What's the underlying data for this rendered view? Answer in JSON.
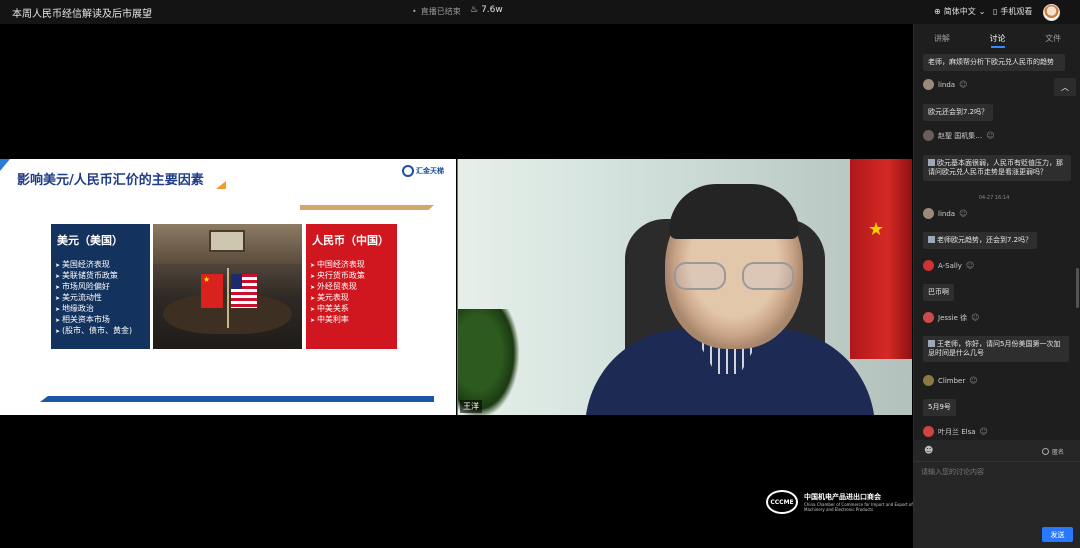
{
  "header": {
    "title": "本周人民币经信解读及后市展望",
    "live_status": "直播已结束",
    "views": "7.6w",
    "language": "简体中文",
    "mobile_watch": "手机观看"
  },
  "slide": {
    "heading": "影响美元/人民币汇价的主要因素",
    "logo_text": "汇金天梯",
    "us_box": {
      "title": "美元（美国）",
      "items": [
        "美国经济表现",
        "美联储货币政策",
        "市场风险偏好",
        "美元流动性",
        "地缘政治",
        "相关资本市场",
        "(股市、债市、黄金)"
      ]
    },
    "cn_box": {
      "title": "人民币（中国）",
      "items": [
        "中国经济表现",
        "央行货币政策",
        "外经贸表现",
        "美元表现",
        "中美关系",
        "中美利率"
      ]
    }
  },
  "camera": {
    "speaker_name": "王洋"
  },
  "sponsor": {
    "name_cn": "中国机电产品进出口商会",
    "name_en": "China Chamber of Commerce for Import and Export of Machinery and Electronic Products",
    "mark": "CCCME"
  },
  "panel": {
    "tabs": [
      "讲解",
      "讨论",
      "文件"
    ],
    "active_tab": "讨论",
    "scroll_up": "︿",
    "messages": [
      {
        "type": "msg",
        "text": "老师，麻烦帮分析下欧元兑人民币的趋势"
      },
      {
        "type": "user",
        "name": "linda"
      },
      {
        "type": "msg",
        "text": "欧元还会到7.2吗？"
      },
      {
        "type": "user",
        "name": "赵聖 国机集…"
      },
      {
        "type": "msg",
        "text": "欧元基本面很弱，人民币有贬值压力，那请问欧元兑人民币走势是看涨更弱吗？"
      },
      {
        "type": "time",
        "text": "04-27 16:14"
      },
      {
        "type": "user",
        "name": "linda"
      },
      {
        "type": "msg",
        "text": "老师欧元趋势，还会到7.2吗？"
      },
      {
        "type": "user",
        "name": "A-Sally"
      },
      {
        "type": "msg",
        "text": "巴币啊"
      },
      {
        "type": "user",
        "name": "Jessie 徐"
      },
      {
        "type": "msg",
        "text": "王老师，你好，请问5月份美国第一次加息时间是什么几号"
      },
      {
        "type": "user",
        "name": "Climber"
      },
      {
        "type": "msg",
        "text": "5月9号"
      },
      {
        "type": "user",
        "name": "叶月兰 Elsa"
      }
    ],
    "anonymous_label": "匿名",
    "input_placeholder": "请输入您的讨论内容",
    "send_label": "发送"
  },
  "colors": {
    "accent": "#2979ff",
    "us_box": "#14325e",
    "cn_box": "#d0161e",
    "slide_heading": "#1f3c88"
  }
}
